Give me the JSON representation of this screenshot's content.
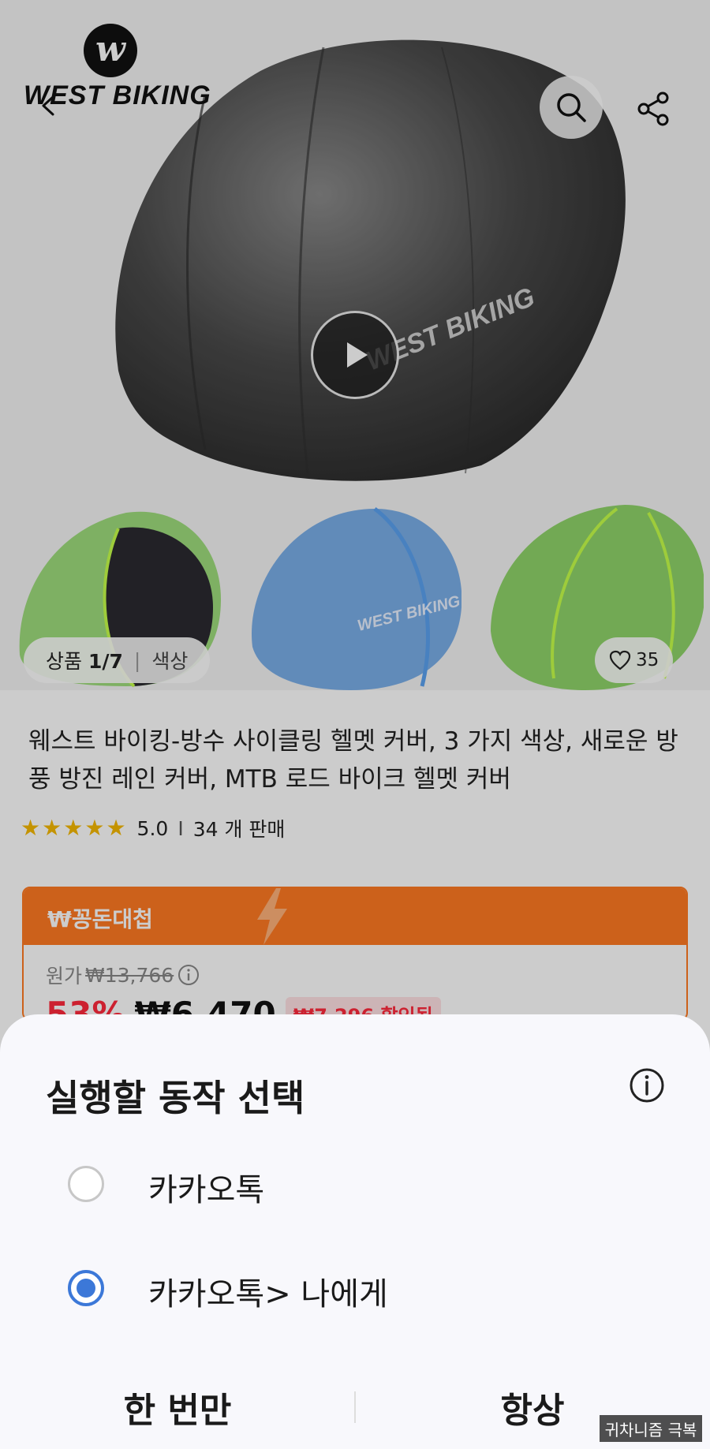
{
  "brand": {
    "mark": "w",
    "name": "WEST BIKING"
  },
  "gallery": {
    "counter_label": "상품",
    "counter_value": "1/7",
    "option_label": "색상",
    "likes": "35",
    "helmet_watermark": "WEST BIKING"
  },
  "product": {
    "title": "웨스트 바이킹-방수 사이클링 헬멧 커버, 3 가지 색상, 새로운 방풍 방진 레인 커버, MTB 로드 바이크 헬멧 커버",
    "rating": "5.0",
    "rating_separator": "I",
    "sold": "34 개 판매"
  },
  "promo": {
    "title": "₩꽁돈대첩",
    "original_label": "원가",
    "original_price": "₩13,766",
    "discount_pct": "53%",
    "price": "₩6,470",
    "discount_amount": "₩7,296 할인됨"
  },
  "sheet": {
    "title": "실행할 동작 선택",
    "options": [
      {
        "label": "카카오톡",
        "selected": false
      },
      {
        "label": "카카오톡> 나에게",
        "selected": true
      }
    ],
    "once_label": "한 번만",
    "always_label": "항상"
  },
  "overlay_watermark": "귀차니즘 극복",
  "colors": {
    "accent_orange": "#ff7a22",
    "price_red": "#ff2a3c",
    "radio_blue": "#3c78d8",
    "star_yellow": "#f5b800"
  },
  "icons": [
    "back-arrow-icon",
    "search-icon",
    "share-icon",
    "play-icon",
    "heart-icon",
    "star-icon",
    "info-icon",
    "lightning-bolt-icon"
  ]
}
